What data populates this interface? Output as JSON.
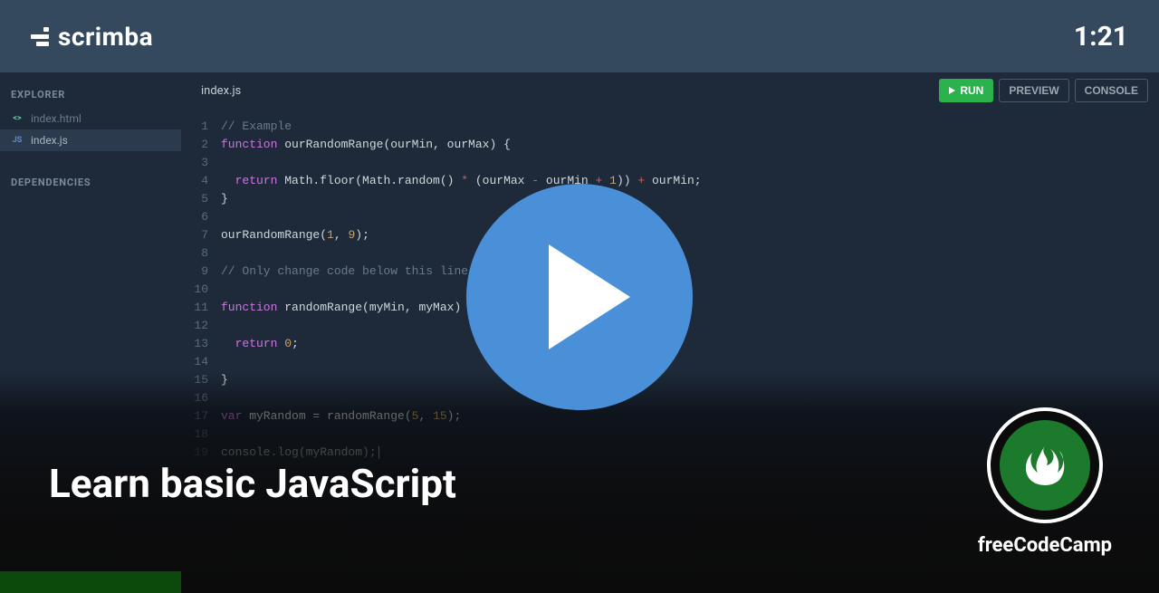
{
  "header": {
    "brand": "scrimba",
    "time": "1:21"
  },
  "sidebar": {
    "explorer_label": "EXPLORER",
    "dependencies_label": "DEPENDENCIES",
    "files": [
      {
        "ext": "<>",
        "name": "index.html",
        "active": false
      },
      {
        "ext": "JS",
        "name": "index.js",
        "active": true
      }
    ]
  },
  "editor": {
    "tab": "index.js",
    "buttons": {
      "run": "RUN",
      "preview": "PREVIEW",
      "console": "CONSOLE"
    },
    "code_lines": [
      [
        {
          "cls": "tk-comment",
          "t": "// Example"
        }
      ],
      [
        {
          "cls": "tk-keyword",
          "t": "function"
        },
        {
          "cls": "tk-plain",
          "t": " ourRandomRange(ourMin, ourMax) {"
        }
      ],
      [],
      [
        {
          "cls": "tk-plain",
          "t": "  "
        },
        {
          "cls": "tk-return",
          "t": "return"
        },
        {
          "cls": "tk-plain",
          "t": " Math.floor(Math.random() "
        },
        {
          "cls": "tk-op",
          "t": "*"
        },
        {
          "cls": "tk-plain",
          "t": " (ourMax "
        },
        {
          "cls": "tk-op",
          "t": "-"
        },
        {
          "cls": "tk-plain",
          "t": " ourMin "
        },
        {
          "cls": "tk-op",
          "t": "+"
        },
        {
          "cls": "tk-plain",
          "t": " "
        },
        {
          "cls": "tk-num",
          "t": "1"
        },
        {
          "cls": "tk-plain",
          "t": ")) "
        },
        {
          "cls": "tk-op",
          "t": "+"
        },
        {
          "cls": "tk-plain",
          "t": " ourMin;"
        }
      ],
      [
        {
          "cls": "tk-plain",
          "t": "}"
        }
      ],
      [],
      [
        {
          "cls": "tk-plain",
          "t": "ourRandomRange("
        },
        {
          "cls": "tk-num",
          "t": "1"
        },
        {
          "cls": "tk-plain",
          "t": ", "
        },
        {
          "cls": "tk-num",
          "t": "9"
        },
        {
          "cls": "tk-plain",
          "t": ");"
        }
      ],
      [],
      [
        {
          "cls": "tk-comment",
          "t": "// Only change code below this line."
        }
      ],
      [],
      [
        {
          "cls": "tk-keyword",
          "t": "function"
        },
        {
          "cls": "tk-plain",
          "t": " randomRange(myMin, myMax) {"
        }
      ],
      [],
      [
        {
          "cls": "tk-plain",
          "t": "  "
        },
        {
          "cls": "tk-return",
          "t": "return"
        },
        {
          "cls": "tk-plain",
          "t": " "
        },
        {
          "cls": "tk-num",
          "t": "0"
        },
        {
          "cls": "tk-plain",
          "t": ";"
        }
      ],
      [],
      [
        {
          "cls": "tk-plain",
          "t": "}"
        }
      ],
      [],
      [
        {
          "cls": "tk-var",
          "t": "var"
        },
        {
          "cls": "tk-plain",
          "t": " myRandom = randomRange("
        },
        {
          "cls": "tk-num",
          "t": "5"
        },
        {
          "cls": "tk-plain",
          "t": ", "
        },
        {
          "cls": "tk-num",
          "t": "15"
        },
        {
          "cls": "tk-plain",
          "t": ");"
        }
      ],
      [],
      [
        {
          "cls": "tk-plain",
          "t": "console.log(myRandom);"
        }
      ]
    ]
  },
  "overlay": {
    "title": "Learn basic JavaScript",
    "channel": "freeCodeCamp"
  }
}
